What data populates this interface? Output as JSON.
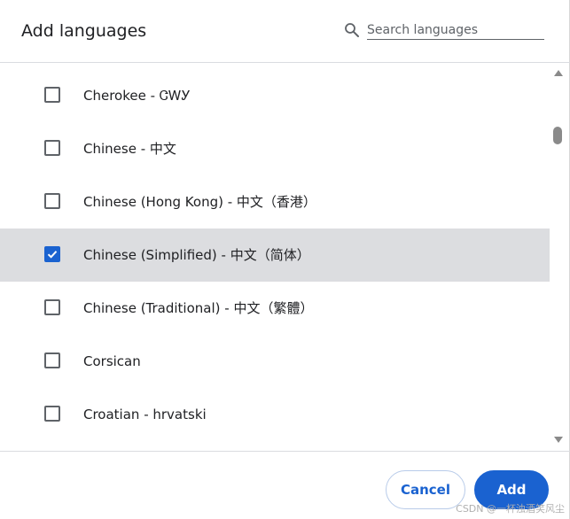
{
  "dialog": {
    "title": "Add languages",
    "search": {
      "placeholder": "Search languages",
      "value": ""
    }
  },
  "languages": [
    {
      "label": "Cherokee - ᏣᎳᎩ",
      "checked": false
    },
    {
      "label": "Chinese - 中文",
      "checked": false
    },
    {
      "label": "Chinese (Hong Kong) - 中文（香港）",
      "checked": false
    },
    {
      "label": "Chinese (Simplified) - 中文（简体）",
      "checked": true
    },
    {
      "label": "Chinese (Traditional) - 中文（繁體）",
      "checked": false
    },
    {
      "label": "Corsican",
      "checked": false
    },
    {
      "label": "Croatian - hrvatski",
      "checked": false
    }
  ],
  "footer": {
    "cancel_label": "Cancel",
    "add_label": "Add"
  },
  "watermark": "CSDN @一杯浊酒笑风尘",
  "colors": {
    "accent": "#1a62d0",
    "selected_row": "#dcdde0"
  }
}
